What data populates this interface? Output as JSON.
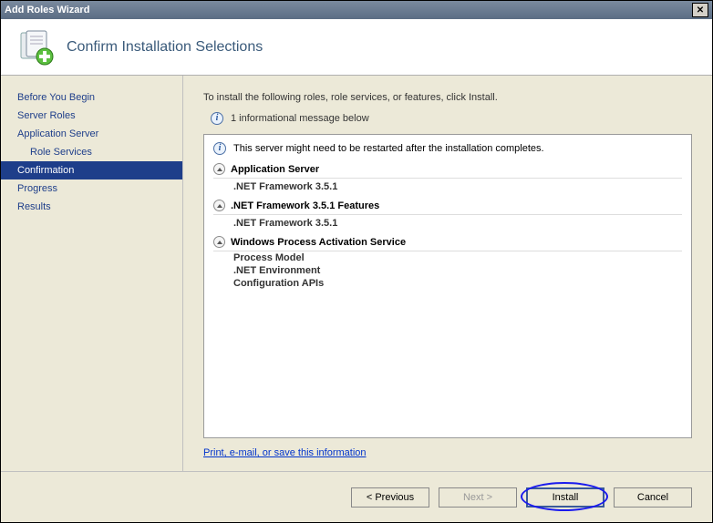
{
  "window": {
    "title": "Add Roles Wizard"
  },
  "header": {
    "title": "Confirm Installation Selections"
  },
  "sidebar": {
    "items": [
      {
        "label": "Before You Begin",
        "active": false,
        "indent": false
      },
      {
        "label": "Server Roles",
        "active": false,
        "indent": false
      },
      {
        "label": "Application Server",
        "active": false,
        "indent": false
      },
      {
        "label": "Role Services",
        "active": false,
        "indent": true
      },
      {
        "label": "Confirmation",
        "active": true,
        "indent": false
      },
      {
        "label": "Progress",
        "active": false,
        "indent": false
      },
      {
        "label": "Results",
        "active": false,
        "indent": false
      }
    ]
  },
  "main": {
    "intro": "To install the following roles, role services, or features, click Install.",
    "info_summary": "1 informational message below",
    "restart_msg": "This server might need to be restarted after the installation completes.",
    "sections": [
      {
        "title": "Application Server",
        "children": [
          ".NET Framework 3.5.1"
        ]
      },
      {
        "title": ".NET Framework 3.5.1 Features",
        "children": [
          ".NET Framework 3.5.1"
        ]
      },
      {
        "title": "Windows Process Activation Service",
        "children": [
          "Process Model",
          ".NET Environment",
          "Configuration APIs"
        ]
      }
    ],
    "save_link": "Print, e-mail, or save this information"
  },
  "footer": {
    "previous": "< Previous",
    "next": "Next >",
    "install": "Install",
    "cancel": "Cancel"
  }
}
